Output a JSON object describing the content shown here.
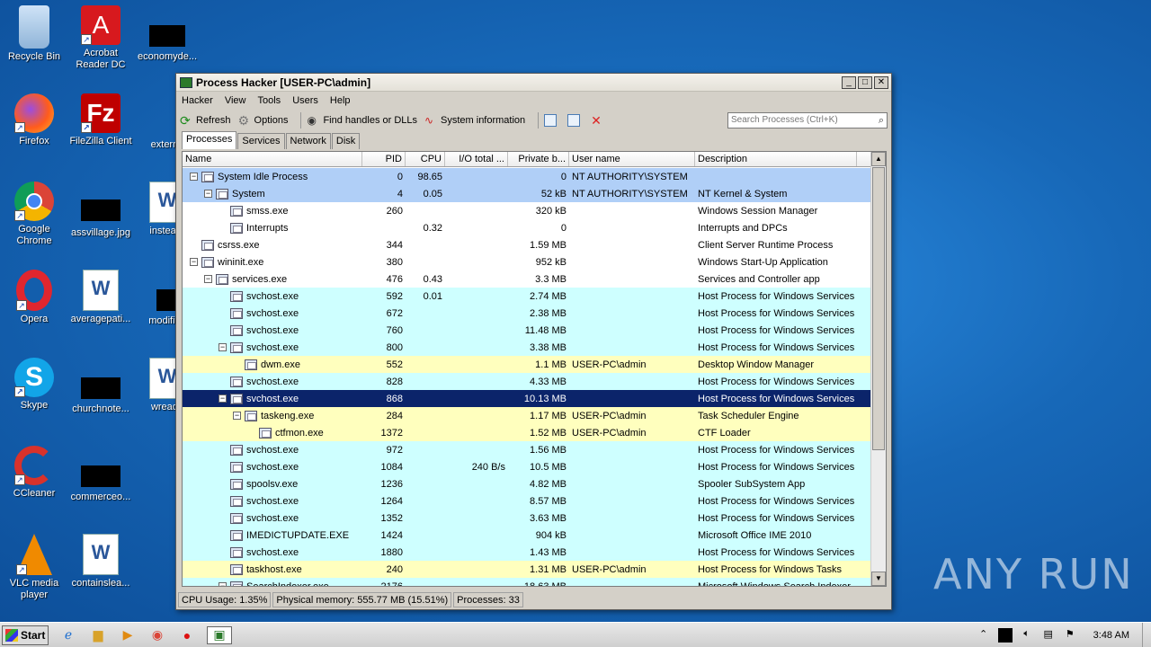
{
  "desktop": {
    "icons": [
      {
        "label": "Recycle Bin"
      },
      {
        "label": "Acrobat Reader DC"
      },
      {
        "label": "economyde..."
      },
      {
        "label": "Firefox"
      },
      {
        "label": "FileZilla Client"
      },
      {
        "label": "externa"
      },
      {
        "label": "Google Chrome"
      },
      {
        "label": "assvillage.jpg"
      },
      {
        "label": "insteadr"
      },
      {
        "label": "Opera"
      },
      {
        "label": "averagepati..."
      },
      {
        "label": "modified"
      },
      {
        "label": "Skype"
      },
      {
        "label": "churchnote..."
      },
      {
        "label": "wreade"
      },
      {
        "label": "CCleaner"
      },
      {
        "label": "commerceo..."
      },
      {
        "label": "VLC media player"
      },
      {
        "label": "containslea..."
      }
    ],
    "watermark": "ANY RUN"
  },
  "window": {
    "title": "Process Hacker [USER-PC\\admin]",
    "menu": [
      "Hacker",
      "View",
      "Tools",
      "Users",
      "Help"
    ],
    "toolbar": {
      "refresh": "Refresh",
      "options": "Options",
      "find_handles": "Find handles or DLLs",
      "system_info": "System information"
    },
    "search_placeholder": "Search Processes (Ctrl+K)",
    "tabs": [
      "Processes",
      "Services",
      "Network",
      "Disk"
    ],
    "columns": [
      "Name",
      "PID",
      "CPU",
      "I/O total ...",
      "Private b...",
      "User name",
      "Description"
    ],
    "rows": [
      {
        "name": "System Idle Process",
        "pid": "0",
        "cpu": "98.65",
        "io": "",
        "priv": "0",
        "user": "NT AUTHORITY\\SYSTEM",
        "desc": "",
        "color": "blue"
      },
      {
        "name": "System",
        "pid": "4",
        "cpu": "0.05",
        "io": "",
        "priv": "52 kB",
        "user": "NT AUTHORITY\\SYSTEM",
        "desc": "NT Kernel & System",
        "color": "blue"
      },
      {
        "name": "smss.exe",
        "pid": "260",
        "cpu": "",
        "io": "",
        "priv": "320 kB",
        "user": "",
        "desc": "Windows Session Manager",
        "color": "white"
      },
      {
        "name": "Interrupts",
        "pid": "",
        "cpu": "0.32",
        "io": "",
        "priv": "0",
        "user": "",
        "desc": "Interrupts and DPCs",
        "color": "white"
      },
      {
        "name": "csrss.exe",
        "pid": "344",
        "cpu": "",
        "io": "",
        "priv": "1.59 MB",
        "user": "",
        "desc": "Client Server Runtime Process",
        "color": "white"
      },
      {
        "name": "wininit.exe",
        "pid": "380",
        "cpu": "",
        "io": "",
        "priv": "952 kB",
        "user": "",
        "desc": "Windows Start-Up Application",
        "color": "white"
      },
      {
        "name": "services.exe",
        "pid": "476",
        "cpu": "0.43",
        "io": "",
        "priv": "3.3 MB",
        "user": "",
        "desc": "Services and Controller app",
        "color": "white"
      },
      {
        "name": "svchost.exe",
        "pid": "592",
        "cpu": "0.01",
        "io": "",
        "priv": "2.74 MB",
        "user": "",
        "desc": "Host Process for Windows Services",
        "color": "cyan"
      },
      {
        "name": "svchost.exe",
        "pid": "672",
        "cpu": "",
        "io": "",
        "priv": "2.38 MB",
        "user": "",
        "desc": "Host Process for Windows Services",
        "color": "cyan"
      },
      {
        "name": "svchost.exe",
        "pid": "760",
        "cpu": "",
        "io": "",
        "priv": "11.48 MB",
        "user": "",
        "desc": "Host Process for Windows Services",
        "color": "cyan"
      },
      {
        "name": "svchost.exe",
        "pid": "800",
        "cpu": "",
        "io": "",
        "priv": "3.38 MB",
        "user": "",
        "desc": "Host Process for Windows Services",
        "color": "cyan"
      },
      {
        "name": "dwm.exe",
        "pid": "552",
        "cpu": "",
        "io": "",
        "priv": "1.1 MB",
        "user": "USER-PC\\admin",
        "desc": "Desktop Window Manager",
        "color": "yellow"
      },
      {
        "name": "svchost.exe",
        "pid": "828",
        "cpu": "",
        "io": "",
        "priv": "4.33 MB",
        "user": "",
        "desc": "Host Process for Windows Services",
        "color": "cyan"
      },
      {
        "name": "svchost.exe",
        "pid": "868",
        "cpu": "",
        "io": "",
        "priv": "10.13 MB",
        "user": "",
        "desc": "Host Process for Windows Services",
        "color": "sel"
      },
      {
        "name": "taskeng.exe",
        "pid": "284",
        "cpu": "",
        "io": "",
        "priv": "1.17 MB",
        "user": "USER-PC\\admin",
        "desc": "Task Scheduler Engine",
        "color": "yellow"
      },
      {
        "name": "ctfmon.exe",
        "pid": "1372",
        "cpu": "",
        "io": "",
        "priv": "1.52 MB",
        "user": "USER-PC\\admin",
        "desc": "CTF Loader",
        "color": "yellow"
      },
      {
        "name": "svchost.exe",
        "pid": "972",
        "cpu": "",
        "io": "",
        "priv": "1.56 MB",
        "user": "",
        "desc": "Host Process for Windows Services",
        "color": "cyan"
      },
      {
        "name": "svchost.exe",
        "pid": "1084",
        "cpu": "",
        "io": "240 B/s",
        "priv": "10.5 MB",
        "user": "",
        "desc": "Host Process for Windows Services",
        "color": "cyan"
      },
      {
        "name": "spoolsv.exe",
        "pid": "1236",
        "cpu": "",
        "io": "",
        "priv": "4.82 MB",
        "user": "",
        "desc": "Spooler SubSystem App",
        "color": "cyan"
      },
      {
        "name": "svchost.exe",
        "pid": "1264",
        "cpu": "",
        "io": "",
        "priv": "8.57 MB",
        "user": "",
        "desc": "Host Process for Windows Services",
        "color": "cyan"
      },
      {
        "name": "svchost.exe",
        "pid": "1352",
        "cpu": "",
        "io": "",
        "priv": "3.63 MB",
        "user": "",
        "desc": "Host Process for Windows Services",
        "color": "cyan"
      },
      {
        "name": "IMEDICTUPDATE.EXE",
        "pid": "1424",
        "cpu": "",
        "io": "",
        "priv": "904 kB",
        "user": "",
        "desc": "Microsoft Office IME 2010",
        "color": "cyan"
      },
      {
        "name": "svchost.exe",
        "pid": "1880",
        "cpu": "",
        "io": "",
        "priv": "1.43 MB",
        "user": "",
        "desc": "Host Process for Windows Services",
        "color": "cyan"
      },
      {
        "name": "taskhost.exe",
        "pid": "240",
        "cpu": "",
        "io": "",
        "priv": "1.31 MB",
        "user": "USER-PC\\admin",
        "desc": "Host Process for Windows Tasks",
        "color": "yellow"
      },
      {
        "name": "SearchIndexer.exe",
        "pid": "2176",
        "cpu": "",
        "io": "",
        "priv": "18.63 MB",
        "user": "",
        "desc": "Microsoft Windows Search Indexer",
        "color": "cyan"
      }
    ],
    "status": {
      "cpu": "CPU Usage: 1.35%",
      "memory": "Physical memory: 555.77 MB (15.51%)",
      "processes": "Processes: 33"
    }
  },
  "taskbar": {
    "start": "Start",
    "clock": "3:48 AM"
  }
}
